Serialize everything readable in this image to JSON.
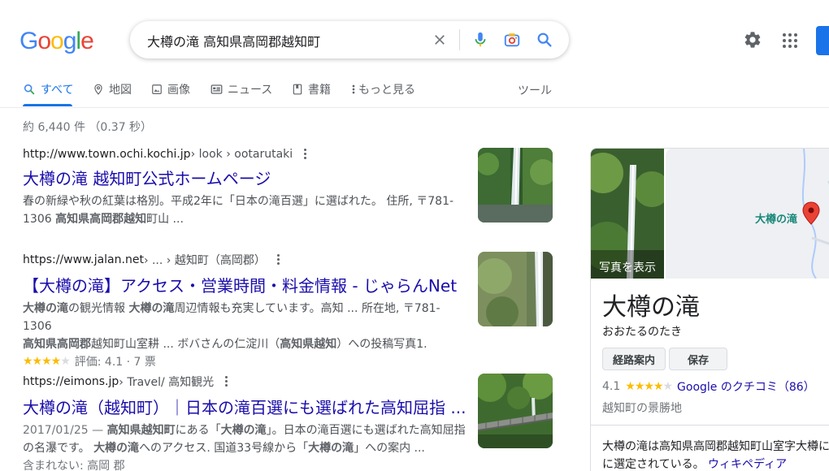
{
  "logo": {
    "letters": [
      "G",
      "o",
      "o",
      "g",
      "l",
      "e"
    ],
    "colors": [
      "#4285F4",
      "#EA4335",
      "#FBBC05",
      "#4285F4",
      "#34A853",
      "#EA4335"
    ]
  },
  "search": {
    "query": "大樽の滝 高知県高岡郡越知町"
  },
  "tabs": [
    {
      "label": "すべて",
      "icon": "search-icon"
    },
    {
      "label": "地図",
      "icon": "map-pin-icon"
    },
    {
      "label": "画像",
      "icon": "image-icon"
    },
    {
      "label": "ニュース",
      "icon": "news-icon"
    },
    {
      "label": "書籍",
      "icon": "book-icon"
    },
    {
      "label": "もっと見る",
      "icon": "more-vert-icon"
    }
  ],
  "tools_label": "ツール",
  "stats": "約 6,440 件 （0.37 秒）",
  "results": [
    {
      "site": "http://www.town.ochi.kochi.jp",
      "path": " › look › ootarutaki",
      "title": "大樽の滝 越知町公式ホームページ",
      "snippet_line1": "春の新緑や秋の紅葉は格別。平成2年に「日本の滝百選」に選ばれた。 住所, 〒781-",
      "snippet_line2_a": "1306 ",
      "snippet_line2_b": "高知県高岡郡越知",
      "snippet_line2_c": "町山 ..."
    },
    {
      "site": "https://www.jalan.net",
      "path": " › ... › 越知町（高岡郡）",
      "title": "【大樽の滝】アクセス・営業時間・料金情報 - じゃらんNet",
      "s1a": "大樽の滝",
      "s1b": "の観光情報 ",
      "s1c": "大樽の滝",
      "s1d": "周辺情報も充実しています。高知 ... 所在地, 〒781-1306",
      "s2a": "高知県高岡郡",
      "s2b": "越知町山室耕 ... ボバさんの仁淀川（",
      "s2c": "高知県越知",
      "s2d": "）への投稿写真1.",
      "rating_text": "評価: 4.1 · 7 票"
    },
    {
      "site": "https://eimons.jp",
      "path": " › Travel/ 高知観光",
      "title": "大樽の滝（越知町）｜日本の滝百選にも選ばれた高知屈指 ...",
      "s1a": "2017/01/25 — ",
      "s1b": "高知県越知町",
      "s1c": "にある「",
      "s1d": "大樽の滝",
      "s1e": "」。日本の滝百選にも選ばれた高知屈指",
      "s2a": "の名瀑です。 ",
      "s2b": "大樽の滝",
      "s2c": "へのアクセス. 国道33号線から「",
      "s2d": "大樽の滝",
      "s2e": "」への案内 ...",
      "missing": "含まれない: 高岡 郡"
    }
  ],
  "knowledge_panel": {
    "photo_label": "写真を表示",
    "map_label": "大樽の滝",
    "title": "大樽の滝",
    "reading": "おおたるのたき",
    "btn_directions": "経路案内",
    "btn_save": "保存",
    "rating": "4.1",
    "reviews_link": "Google のクチコミ（86）",
    "type": "越知町の景勝地",
    "desc_line1": "大樽の滝は高知県高岡郡越知町山室字大樽に",
    "desc_line2": "に選定されている。",
    "wiki_link": "ウィキペディア"
  }
}
